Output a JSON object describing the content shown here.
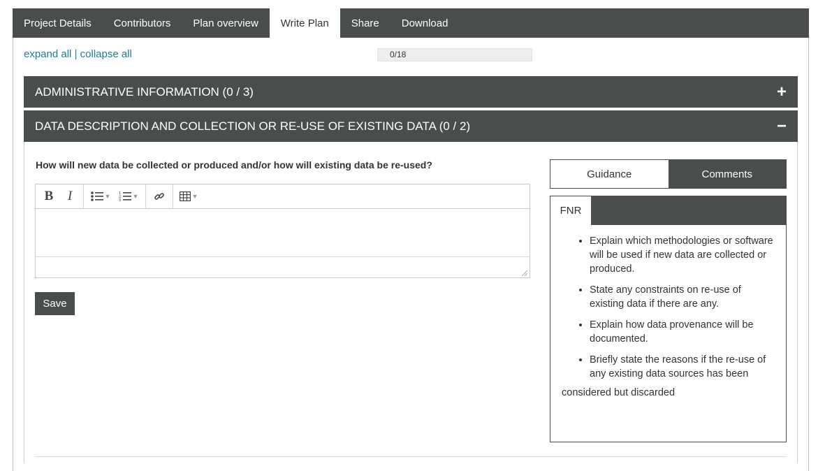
{
  "tabs": [
    "Project Details",
    "Contributors",
    "Plan overview",
    "Write Plan",
    "Share",
    "Download"
  ],
  "active_tab": "Write Plan",
  "expand_all": "expand all",
  "separator": "|",
  "collapse_all": "collapse all",
  "progress": {
    "text": "0/18",
    "answered": 0,
    "total": 18
  },
  "sections": [
    {
      "title": "ADMINISTRATIVE INFORMATION (0 / 3)",
      "toggle": "+",
      "expanded": false
    },
    {
      "title": "DATA DESCRIPTION AND COLLECTION OR RE-USE OF EXISTING DATA (0 / 2)",
      "toggle": "−",
      "expanded": true
    }
  ],
  "question": "How will new data be collected or produced and/or how will existing data be re-used?",
  "editor": {
    "bold": "B",
    "italic": "I",
    "icons": [
      "bold-icon",
      "italic-icon",
      "bullet-list-icon",
      "numbered-list-icon",
      "link-icon",
      "table-icon"
    ],
    "value": ""
  },
  "save_label": "Save",
  "side_tabs": {
    "guidance": "Guidance",
    "comments": "Comments"
  },
  "guidance": {
    "org_tab": "FNR",
    "items": [
      "Explain which methodologies or software will be used if new data are collected or produced.",
      "State any constraints on re-use of existing data if there are any.",
      "Explain how data provenance will be documented.",
      "Briefly state the reasons if the re-use of any existing data sources has been"
    ],
    "tail": "considered but discarded"
  },
  "colors": {
    "dark": "#4a4d4e",
    "link": "#1c7c93"
  }
}
